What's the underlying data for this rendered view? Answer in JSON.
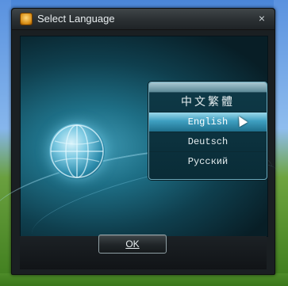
{
  "window": {
    "title": "Select Language",
    "close_glyph": "×",
    "icon": "app-icon"
  },
  "languages": [
    {
      "label": "中文繁體",
      "selected": false
    },
    {
      "label": "English",
      "selected": true
    },
    {
      "label": "Deutsch",
      "selected": false
    },
    {
      "label": "Русский",
      "selected": false
    }
  ],
  "footer": {
    "ok_label": "OK"
  }
}
